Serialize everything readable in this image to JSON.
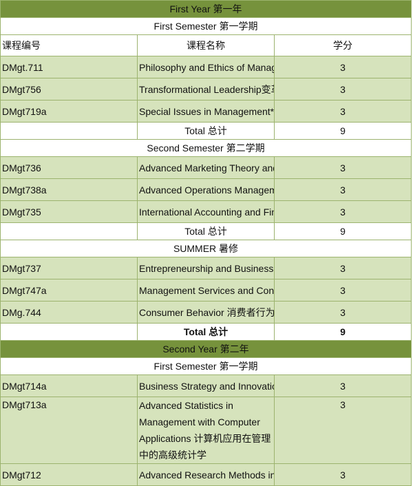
{
  "year1": {
    "title": "First Year 第一年",
    "header": {
      "code": "课程编号",
      "name": "课程名称",
      "credit": "学分"
    },
    "sem1": {
      "title": "First Semester 第一学期",
      "courses": [
        {
          "code": "DMgt.711",
          "name": "Philosophy and Ethics of Management 哲学和伦理道德的管理",
          "credit": "3"
        },
        {
          "code": "DMgt756",
          "name": "Transformational Leadership变革型领导",
          "credit": "3"
        },
        {
          "code": "DMgt719a",
          "name": "Special Issues in Management*管理中的特殊问题",
          "credit": "3"
        }
      ],
      "total_label": "Total  总计",
      "total": "9"
    },
    "sem2": {
      "title": "Second Semester 第二学期",
      "courses": [
        {
          "code": "DMgt736",
          "name": "Advanced Marketing Theory and Practice高级营销理论和实践",
          "credit": "3"
        },
        {
          "code": "DMgt738a",
          "name": "Advanced Operations Management 高级运营管理",
          "credit": "3"
        },
        {
          "code": "DMgt735",
          "name": "International Accounting and Finance* 国际会计与金融",
          "credit": "3"
        }
      ],
      "total_label": "Total  总计",
      "total": "9"
    },
    "summer": {
      "title": "SUMMER 暑修",
      "courses": [
        {
          "code": "DMgt737",
          "name": "Entrepreneurship and Business Development 企业精神和商业发展",
          "credit": "3"
        },
        {
          "code": "DMgt747a",
          "name": "Management Services and Consultancy 管理服务及顾问",
          "credit": "3"
        },
        {
          "code": "DMg.744",
          "name": "Consumer Behavior 消费者行为学",
          "credit": "3"
        }
      ],
      "total_label": "Total  总计",
      "total": "9"
    }
  },
  "year2": {
    "title": "Second Year 第二年",
    "sem1": {
      "title": "First Semester 第一学期",
      "courses": [
        {
          "code": "DMgt714a",
          "name": "Business Strategy and Innovation 商业策略与创新",
          "credit": "3"
        },
        {
          "code": "DMgt713a",
          "name": "Advanced Statistics in Management with Computer Applications 计算机应用在管理中的高级统计学",
          "credit": "3"
        },
        {
          "code": "DMgt712",
          "name": "Advanced Research Methods in Management管理中的高级研究方法",
          "credit": "3"
        }
      ]
    }
  },
  "colors": {
    "year_band": "#76923c",
    "row_fill": "#d6e3bc",
    "border": "#9cb36e"
  }
}
